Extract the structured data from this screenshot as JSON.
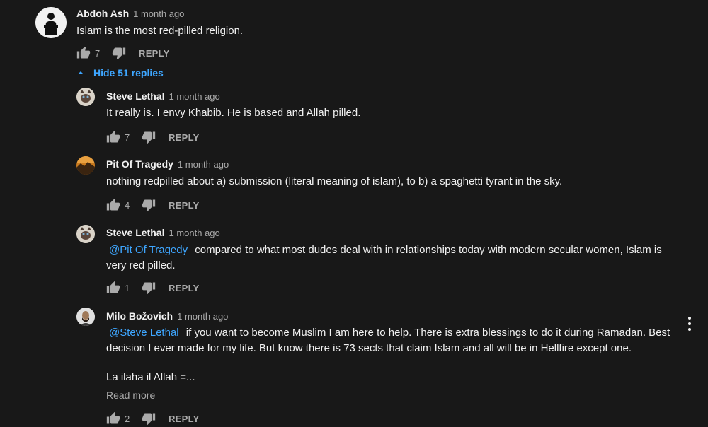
{
  "top_comment": {
    "author": "Abdoh Ash",
    "time": "1 month ago",
    "text": "Islam is the most red-pilled religion.",
    "likes": "7",
    "reply_label": "REPLY"
  },
  "hide_replies_label": "Hide 51 replies",
  "replies": [
    {
      "author": "Steve Lethal",
      "time": "1 month ago",
      "text": "It really is. I envy Khabib. He is based and Allah pilled.",
      "likes": "7",
      "reply_label": "REPLY"
    },
    {
      "author": "Pit Of Tragedy",
      "time": "1 month ago",
      "text": "nothing redpilled about a) submission (literal meaning of islam), to b) a spaghetti tyrant in the sky.",
      "likes": "4",
      "reply_label": "REPLY"
    },
    {
      "author": "Steve Lethal",
      "time": "1 month ago",
      "mention": "@Pit Of Tragedy",
      "text_line1": "compared to what most dudes deal with in relationships today with modern secular women, Islam is",
      "text_line2": "very red pilled.",
      "likes": "1",
      "reply_label": "REPLY"
    },
    {
      "author": "Milo Božovich",
      "time": "1 month ago",
      "mention": "@Steve Lethal",
      "text_line1": "if you want to become Muslim I am here to help.  There is extra blessings to do it during Ramadan.  Best",
      "text_line2": "decision I ever made for my life.  But know there is 73 sects that claim Islam and all will be in Hellfire except one.",
      "text_line3": "La ilaha il Allah =...",
      "read_more": "Read more",
      "likes": "2",
      "reply_label": "REPLY"
    }
  ],
  "colors": {
    "background": "#181818",
    "text": "#f1f1f1",
    "secondary": "#aaaaaa",
    "link": "#3ea6ff"
  }
}
